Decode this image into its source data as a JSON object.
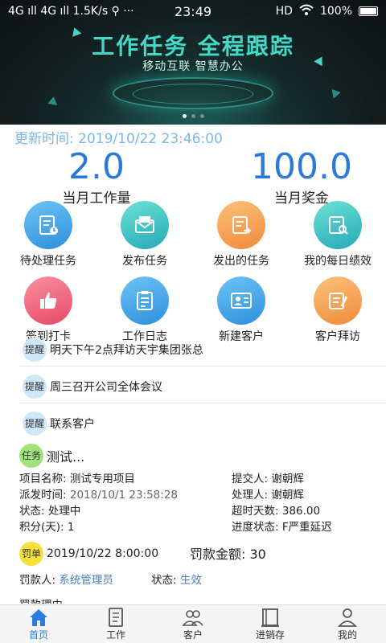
{
  "status_bar": {
    "left": "4G ıll  4G ıll  1.5K/s  ⚲  ···",
    "time": "23:49",
    "hd": "HD",
    "battery": "100%"
  },
  "banner": {
    "title": "工作任务 全程跟踪",
    "subtitle": "移动互联  智慧办公"
  },
  "update_time": "更新时间: 2019/10/22 23:46:00",
  "stats": {
    "workload_value": "2.0",
    "workload_label": "当月工作量",
    "bonus_value": "100.0",
    "bonus_label": "当月奖金"
  },
  "grid": [
    {
      "label": "待处理任务",
      "icon": "pending-task-icon",
      "color": "#2d8fdc"
    },
    {
      "label": "发布任务",
      "icon": "publish-task-icon",
      "color": "#26a9b8"
    },
    {
      "label": "发出的任务",
      "icon": "sent-task-icon",
      "color": "#f08a3a"
    },
    {
      "label": "我的每日绩效",
      "icon": "performance-icon",
      "color": "#26a9b8"
    },
    {
      "label": "签到打卡",
      "icon": "thumbs-up-icon",
      "color": "#e54a66"
    },
    {
      "label": "工作日志",
      "icon": "work-log-icon",
      "color": "#2d8fdc"
    },
    {
      "label": "新建客户",
      "icon": "new-customer-icon",
      "color": "#2d8fdc"
    },
    {
      "label": "客户拜访",
      "icon": "customer-visit-icon",
      "color": "#f08a3a"
    }
  ],
  "reminders": [
    {
      "badge": "提醒",
      "text": "明天下午2点拜访天宇集团张总"
    },
    {
      "badge": "提醒",
      "text": "周三召开公司全体会议"
    },
    {
      "badge": "提醒",
      "text": "联系客户"
    }
  ],
  "task": {
    "badge": "任务",
    "title": "测试...",
    "project_label": "项目名称:",
    "project_value": "测试专用项目",
    "submitter_label": "提交人:",
    "submitter_value": "谢朝辉",
    "dispatch_label": "派发时间:",
    "dispatch_value": "2018/10/1 23:58:28",
    "handler_label": "处理人:",
    "handler_value": "谢朝辉",
    "status_label": "状态:",
    "status_value": "处理中",
    "overdue_label": "超时天数:",
    "overdue_value": "386.00",
    "points_label": "积分(天):",
    "points_value": "1",
    "progress_label": "进度状态:",
    "progress_value": "F严重延迟"
  },
  "penalty": {
    "badge": "罚单",
    "date": "2019/10/22 8:00:00",
    "amount_label": "罚款金额:",
    "amount_value": "30",
    "person_label": "罚款人:",
    "person_value": "系统管理员",
    "state_label": "状态:",
    "state_value": "生效",
    "reason_partial": "罚款理由"
  },
  "nav": [
    {
      "label": "首页",
      "icon": "home-icon",
      "active": true
    },
    {
      "label": "工作",
      "icon": "work-icon",
      "active": false
    },
    {
      "label": "客户",
      "icon": "customers-icon",
      "active": false
    },
    {
      "label": "进销存",
      "icon": "inventory-icon",
      "active": false
    },
    {
      "label": "我的",
      "icon": "profile-icon",
      "active": false
    }
  ],
  "colors": {
    "accent": "#2c79d8",
    "banner_title": "#43d8c8",
    "update_text": "#7ab6e6"
  }
}
